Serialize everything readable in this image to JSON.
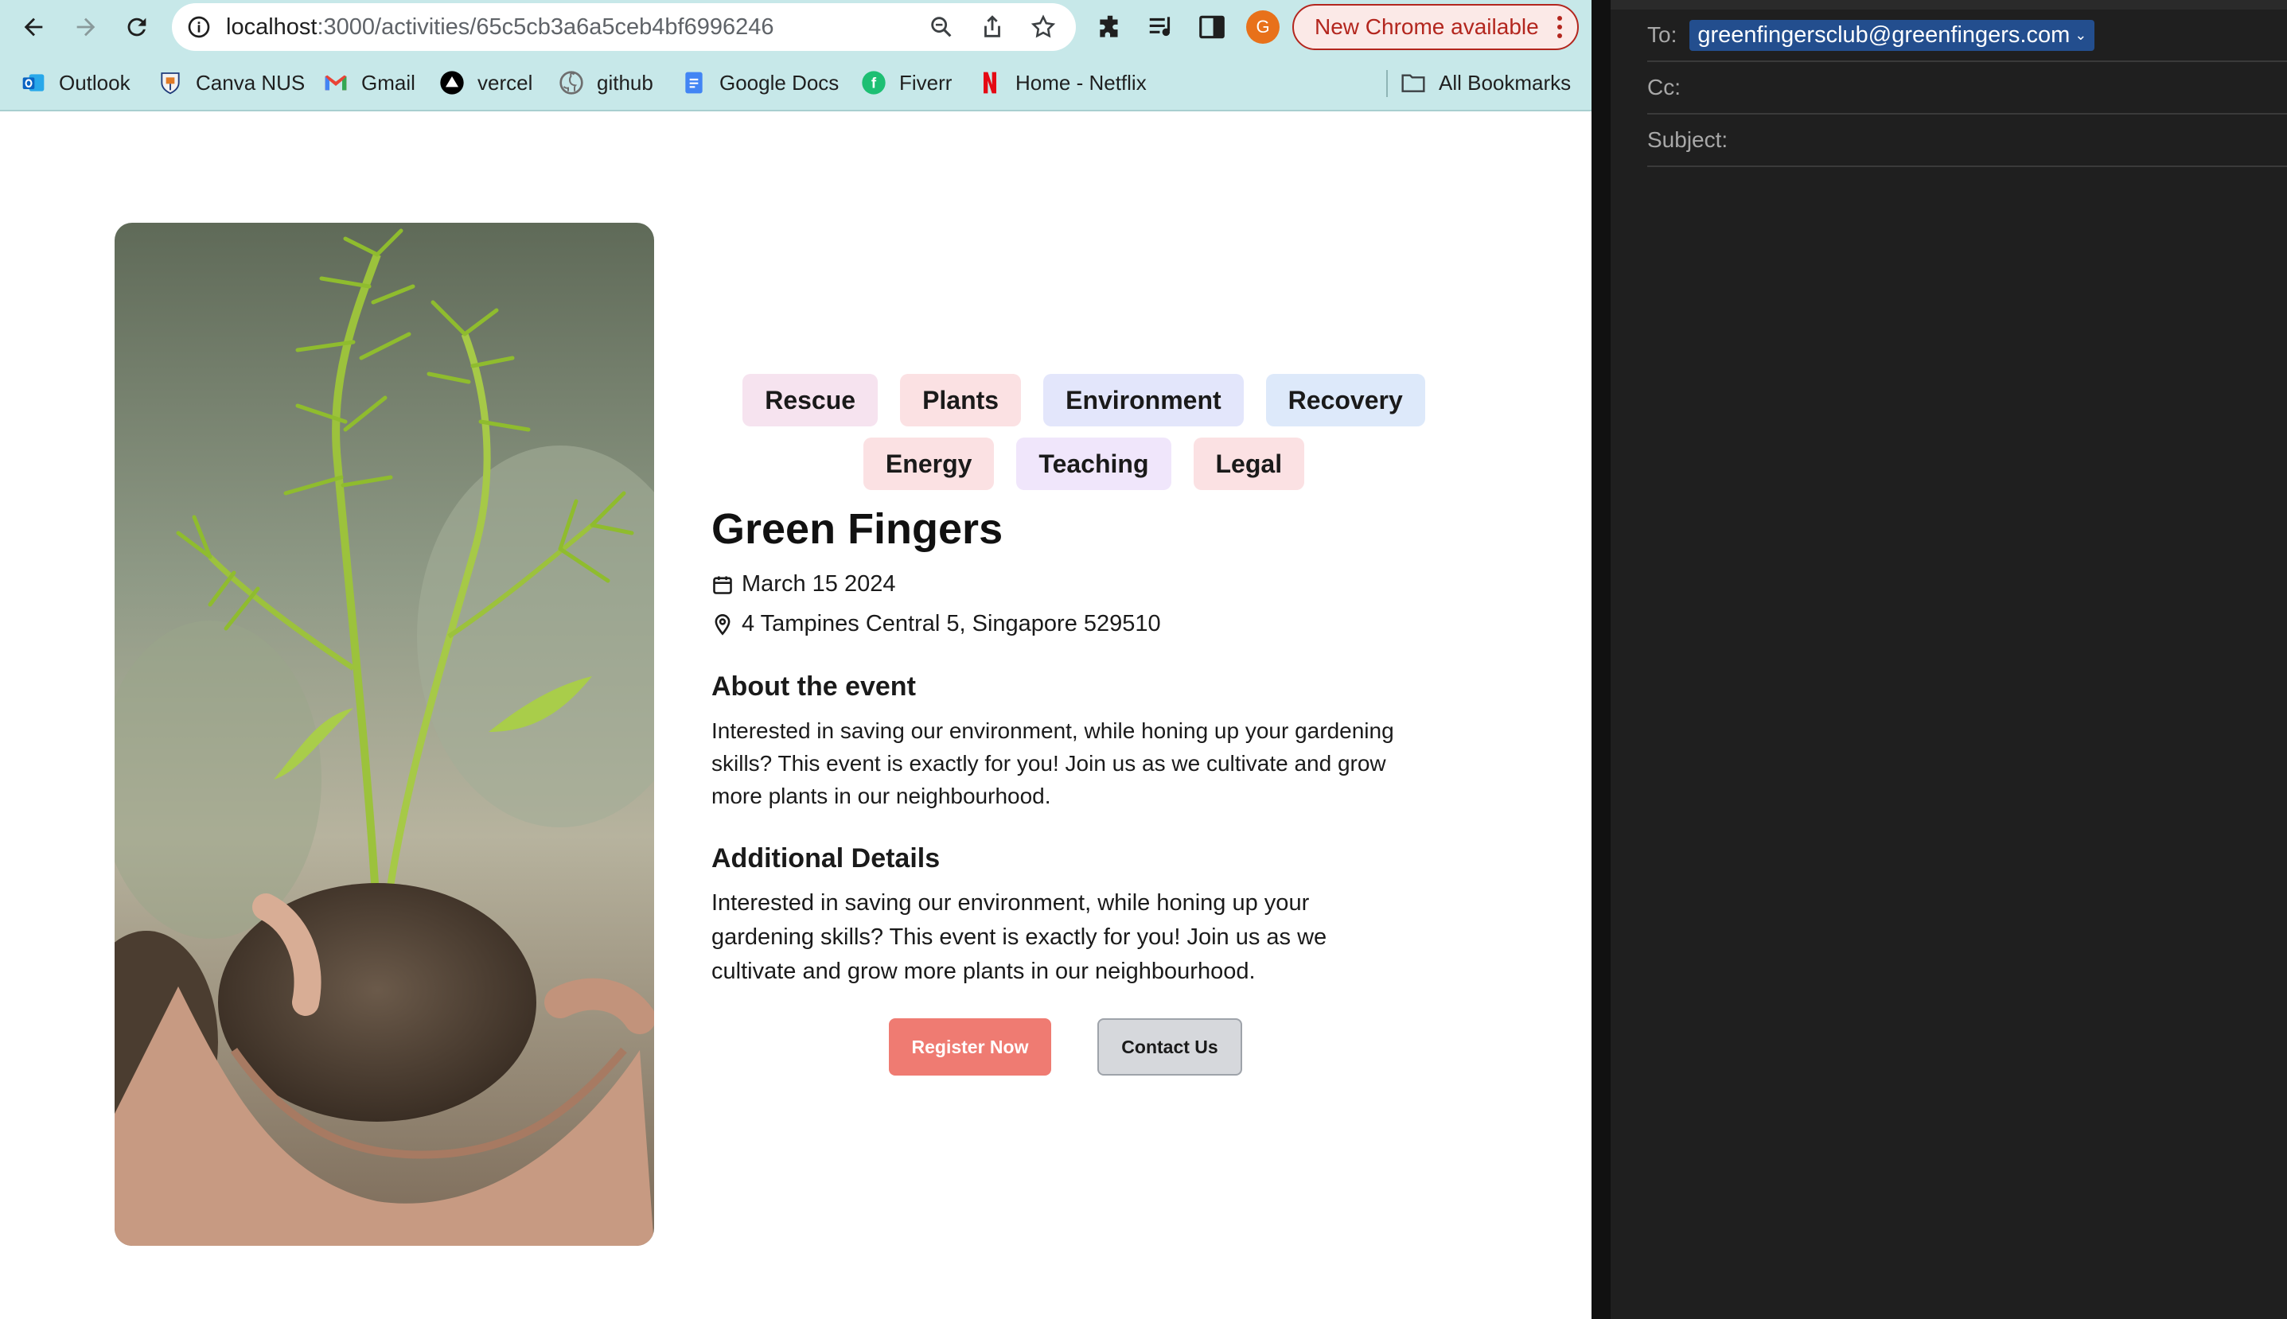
{
  "browser": {
    "url": {
      "host": "localhost",
      "path": ":3000/activities/65c5cb3a6a5ceb4bf6996246"
    },
    "profile_initial": "G",
    "update_button": "New Chrome available",
    "bookmarks": [
      {
        "label": "Outlook",
        "icon": "outlook-icon"
      },
      {
        "label": "Canva NUS",
        "icon": "nus-crest-icon"
      },
      {
        "label": "Gmail",
        "icon": "gmail-icon"
      },
      {
        "label": "vercel",
        "icon": "vercel-icon"
      },
      {
        "label": "github",
        "icon": "github-icon"
      },
      {
        "label": "Google Docs",
        "icon": "google-docs-icon"
      },
      {
        "label": "Fiverr",
        "icon": "fiverr-icon"
      },
      {
        "label": "Home - Netflix",
        "icon": "netflix-icon"
      }
    ],
    "all_bookmarks": "All Bookmarks",
    "colors": {
      "toolbar": "#c7e8e9",
      "update_accent": "#b3261e"
    }
  },
  "event": {
    "tags_row1": [
      {
        "label": "Rescue",
        "color": "#f6e3ef"
      },
      {
        "label": "Plants",
        "color": "#fbe1e3"
      },
      {
        "label": "Environment",
        "color": "#e3e6fb"
      },
      {
        "label": "Recovery",
        "color": "#dde9fa"
      }
    ],
    "tags_row2": [
      {
        "label": "Energy",
        "color": "#fbe1e3"
      },
      {
        "label": "Teaching",
        "color": "#f0e6fb"
      },
      {
        "label": "Legal",
        "color": "#fbe1e3"
      }
    ],
    "title": "Green Fingers",
    "date": "March 15 2024",
    "location": "4 Tampines Central 5, Singapore 529510",
    "about_heading": "About the event",
    "about_text": "Interested in saving our environment, while honing up your gardening skills? This event is exactly for you! Join us as we cultivate and grow more plants in our neighbourhood.",
    "details_heading": "Additional Details",
    "details_text": "Interested in saving our environment, while honing up your gardening skills? This event is exactly for you! Join us as we cultivate and grow more plants in our neighbourhood.",
    "register_label": "Register Now",
    "contact_label": "Contact Us",
    "colors": {
      "register": "#ef7b72",
      "contact": "#d6d8dc"
    }
  },
  "mail": {
    "to_label": "To:",
    "to_value": "greenfingersclub@greenfingers.com",
    "cc_label": "Cc:",
    "subject_label": "Subject:"
  }
}
